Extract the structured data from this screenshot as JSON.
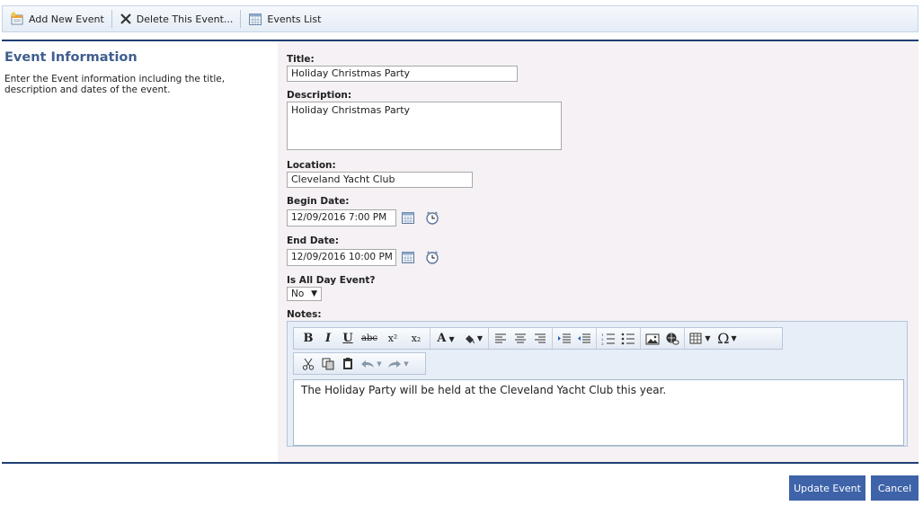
{
  "toolbar": {
    "add_label": "Add New Event",
    "delete_label": "Delete This Event...",
    "list_label": "Events List"
  },
  "section": {
    "title": "Event Information",
    "description": "Enter the Event information including the title, description and dates of the event."
  },
  "form": {
    "title_label": "Title:",
    "title_value": "Holiday Christmas Party",
    "description_label": "Description:",
    "description_value": "Holiday Christmas Party",
    "location_label": "Location:",
    "location_value": "Cleveland Yacht Club",
    "begin_label": "Begin Date:",
    "begin_value": "12/09/2016 7:00 PM",
    "end_label": "End Date:",
    "end_value": "12/09/2016 10:00 PM",
    "allday_label": "Is All Day Event?",
    "allday_value": "No",
    "notes_label": "Notes:",
    "notes_value": "The Holiday Party will be held at the Cleveland Yacht Club this year."
  },
  "editor_toolbar": {
    "bold": "B",
    "italic": "I",
    "underline": "U",
    "strike": "abc",
    "superscript": "x²",
    "subscript": "x₂",
    "font_color": "A",
    "special_chars": "Ω"
  },
  "actions": {
    "update_label": "Update Event",
    "cancel_label": "Cancel"
  },
  "icons": {
    "add": "add-event-icon",
    "delete": "close-x-icon",
    "list": "calendar-grid-icon",
    "calendar": "calendar-icon",
    "clock": "clock-icon"
  },
  "colors": {
    "accent": "#3e63a9",
    "heading": "#3f5f8f",
    "rule": "#1f3f73",
    "form_bg": "#f5f1f4"
  }
}
